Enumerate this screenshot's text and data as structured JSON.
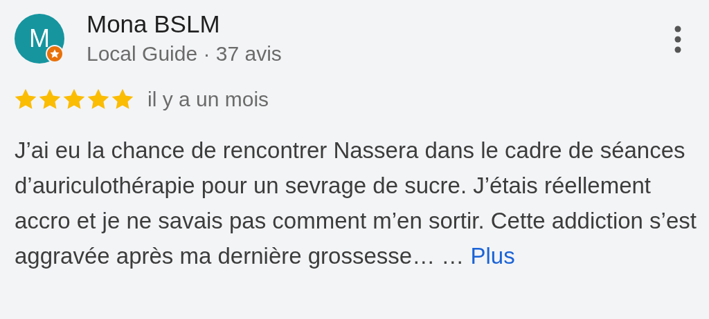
{
  "reviewer": {
    "initial": "M",
    "name": "Mona BSLM",
    "details": "Local Guide · 37 avis",
    "local_guide": true
  },
  "rating": {
    "stars": 5
  },
  "date": "il y a un mois",
  "review": {
    "text": "J’ai eu la chance de rencontrer Nassera dans le cadre de séances d’auriculothérapie pour un sevrage de sucre. J’étais réellement accro et je ne savais pas comment m’en sortir. Cette addiction s’est aggravée après ma dernière grossesse… …",
    "more_link": "Plus"
  }
}
